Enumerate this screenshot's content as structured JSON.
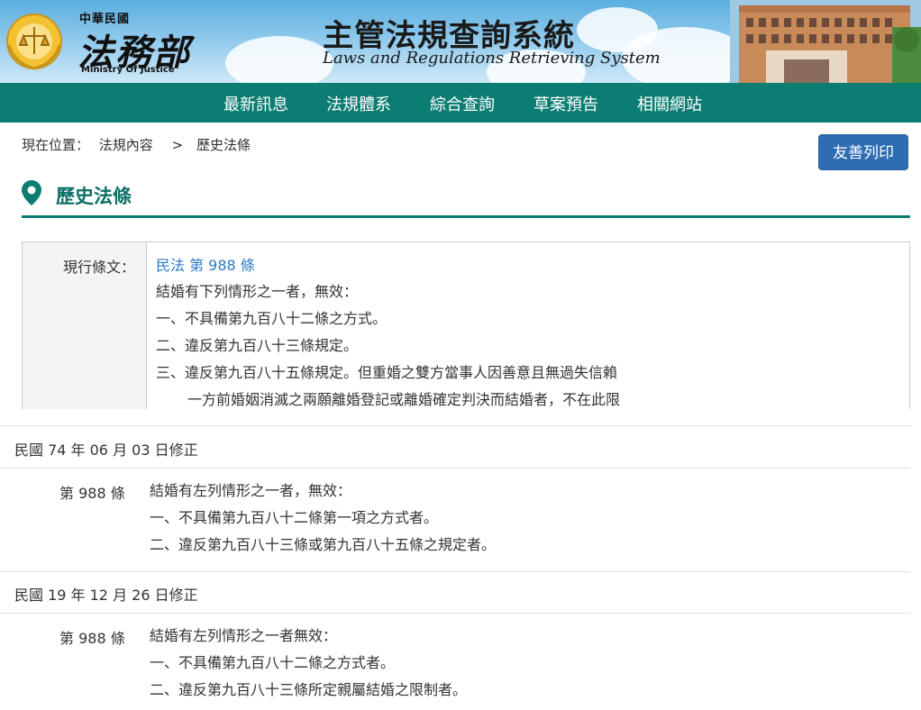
{
  "header": {
    "logo_small": "中華民國",
    "logo_big": "法務部",
    "logo_en": "Ministry Of Justice",
    "system_title": "主管法規查詢系統",
    "system_subtitle": "Laws and Regulations Retrieving System"
  },
  "nav": {
    "items": [
      "最新訊息",
      "法規體系",
      "綜合查詢",
      "草案預告",
      "相關網站"
    ]
  },
  "breadcrumb": {
    "label": "現在位置：",
    "items": [
      "法規內容",
      "歷史法條"
    ],
    "separator": ">"
  },
  "print_button": "友善列印",
  "page_title": "歷史法條",
  "current": {
    "label": "現行條文：",
    "link": "民法 第 988 條",
    "lines": [
      "結婚有下列情形之一者，無效：",
      "一、不具備第九百八十二條之方式。",
      "二、違反第九百八十三條規定。",
      "三、違反第九百八十五條規定。但重婚之雙方當事人因善意且無過失信賴",
      "一方前婚姻消滅之兩願離婚登記或離婚確定判決而結婚者，不在此限"
    ]
  },
  "history": [
    {
      "date": "民國 74 年 06 月 03 日修正",
      "article": "第 988 條",
      "lines": [
        "結婚有左列情形之一者，無效：",
        "一、不具備第九百八十二條第一項之方式者。",
        "二、違反第九百八十三條或第九百八十五條之規定者。"
      ]
    },
    {
      "date": "民國 19 年 12 月 26 日修正",
      "article": "第 988 條",
      "lines": [
        "結婚有左列情形之一者無效：",
        "一、不具備第九百八十二條之方式者。",
        "二、違反第九百八十三條所定親屬結婚之限制者。"
      ]
    }
  ],
  "colors": {
    "nav_bg": "#0c7d72",
    "title_color": "#0c6f66",
    "link_color": "#2b7bc4",
    "button_bg": "#2f6db3"
  }
}
